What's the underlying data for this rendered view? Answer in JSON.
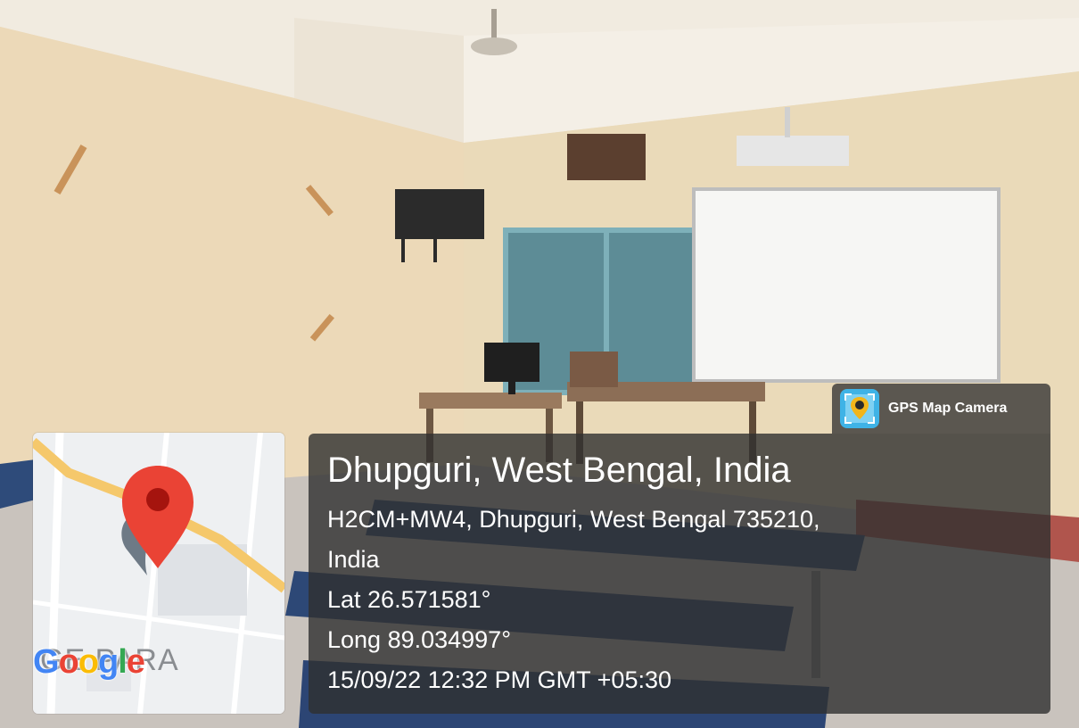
{
  "app": {
    "name": "GPS Map Camera",
    "icon": "gps-map-camera-icon"
  },
  "location": {
    "title": "Dhupguri, West Bengal, India",
    "address_line_1": "H2CM+MW4, Dhupguri, West Bengal 735210,",
    "address_line_2": "India",
    "latitude": "Lat 26.571581°",
    "longitude": "Long 89.034997°",
    "datetime": "15/09/22 12:32 PM GMT +05:30"
  },
  "map": {
    "area_label": "GE PARA",
    "logo_letters": [
      "G",
      "o",
      "o",
      "g",
      "l",
      "e"
    ],
    "pin_icon": "map-pin-icon",
    "pin_color": "#ea4335",
    "road_color": "#f5c86b"
  },
  "colors": {
    "panel_bg": "#303030",
    "panel_text": "#ffffff"
  }
}
